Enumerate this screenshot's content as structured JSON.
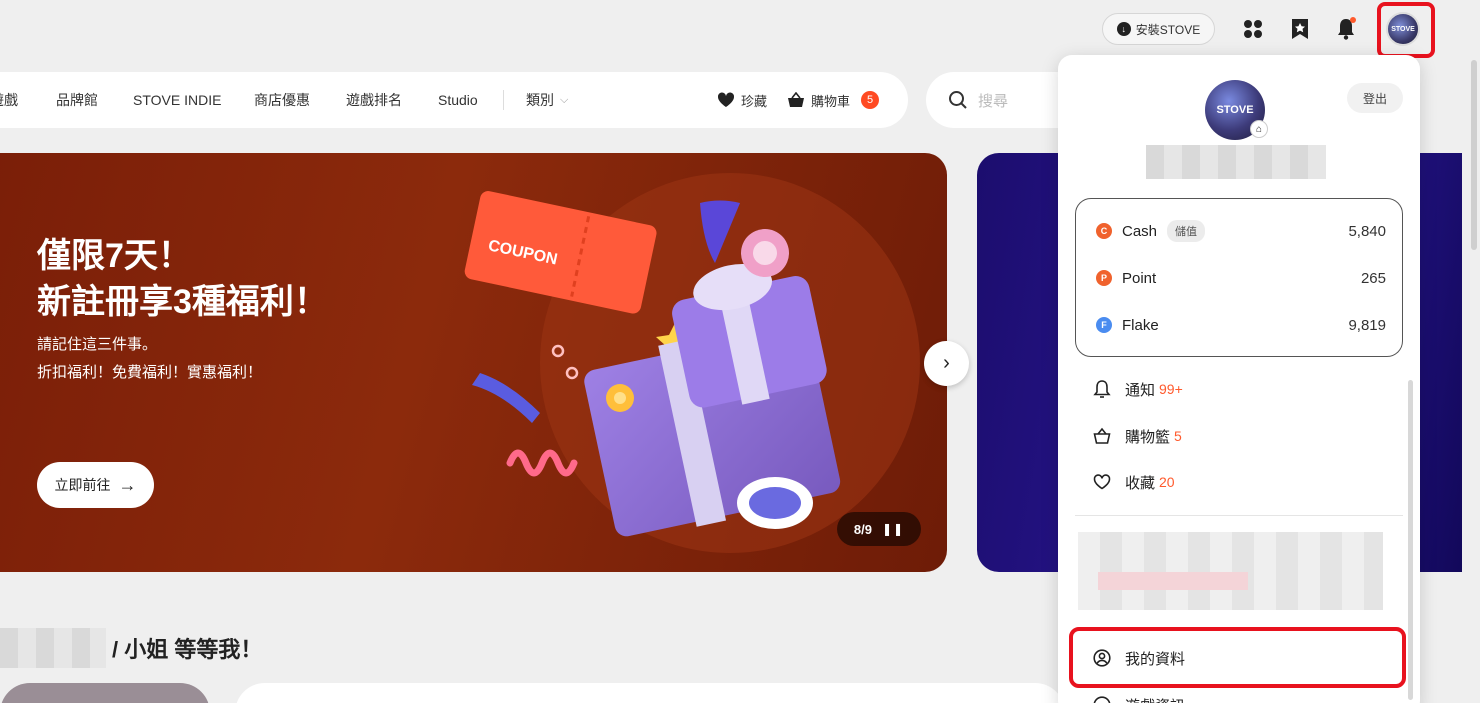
{
  "topbar": {
    "install_label": "安裝STOVE"
  },
  "nav": {
    "items": [
      "遊戲",
      "品牌館",
      "STOVE INDIE",
      "商店優惠",
      "遊戲排名",
      "Studio",
      "類別"
    ],
    "wishlist_label": "珍藏",
    "cart_label": "購物車",
    "cart_count": "5"
  },
  "search": {
    "placeholder": "搜尋"
  },
  "hero": {
    "title_line1": "僅限7天！",
    "title_line2": "新註冊享3種福利！",
    "sub_line1": "請記住這三件事。",
    "sub_line2": "折扣福利！免費福利！實惠福利！",
    "button_label": "立即前往",
    "coupon_label": "COUPON",
    "pager": "8/9"
  },
  "section": {
    "title_suffix": "/ 小姐 等等我！"
  },
  "panel": {
    "logout_label": "登出",
    "avatar_text": "STOVE",
    "wallet": [
      {
        "name": "Cash",
        "letter": "C",
        "color": "#f0622d",
        "amount": "5,840",
        "extra": "儲值"
      },
      {
        "name": "Point",
        "letter": "P",
        "color": "#f0622d",
        "amount": "265",
        "extra": ""
      },
      {
        "name": "Flake",
        "letter": "F",
        "color": "#4a8cf0",
        "amount": "9,819",
        "extra": ""
      }
    ],
    "menu": [
      {
        "label": "通知",
        "count": "99+"
      },
      {
        "label": "購物籃",
        "count": "5"
      },
      {
        "label": "收藏",
        "count": "20"
      }
    ],
    "profile_label": "我的資料",
    "next_label": "遊戲資訊"
  }
}
